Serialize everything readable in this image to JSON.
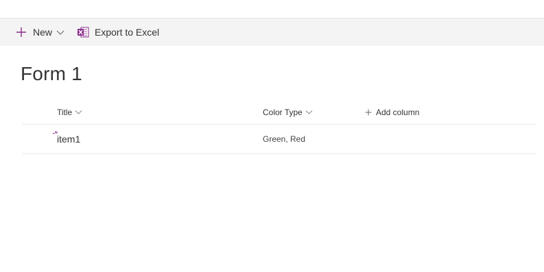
{
  "toolbar": {
    "new_label": "New",
    "export_label": "Export to Excel"
  },
  "page": {
    "title": "Form 1"
  },
  "list": {
    "columns": {
      "title": "Title",
      "color_type": "Color Type",
      "add_column": "Add column"
    },
    "rows": [
      {
        "title": "item1",
        "color_type": "Green, Red"
      }
    ]
  },
  "icons": {
    "new": "plus-icon",
    "new_menu": "chevron-down-icon",
    "export": "excel-icon",
    "sort": "chevron-down-icon",
    "add_column": "plus-icon",
    "new_item": "sparkle-icon"
  },
  "colors": {
    "accent": "#8a2b8b",
    "commandbar_bg": "#f4f4f4",
    "text": "#333333"
  }
}
